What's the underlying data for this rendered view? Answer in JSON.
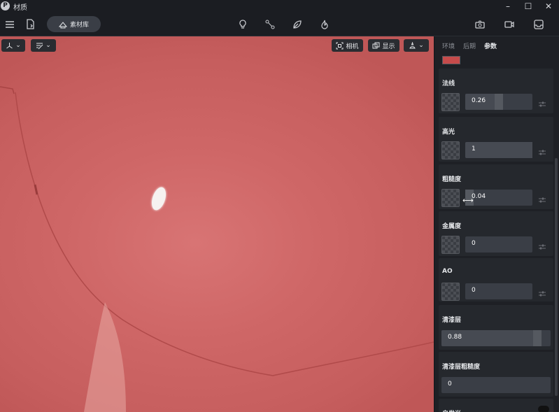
{
  "window": {
    "logo_letter": "P",
    "title": "材质",
    "minimize": "–",
    "maximize": "☐",
    "close": "✕"
  },
  "toolbar": {
    "library_label": "素材库"
  },
  "viewport": {
    "camera_label": "相机",
    "display_label": "显示",
    "chevron": "⌄"
  },
  "panel": {
    "tabs": [
      "环境",
      "后期",
      "参数"
    ],
    "active_tab": "参数",
    "base_color": "#c64b4b",
    "params": [
      {
        "label": "法线",
        "value": "0.26",
        "fill": 0.5
      },
      {
        "label": "高光",
        "value": "1",
        "fill": 1.0
      },
      {
        "label": "粗糙度",
        "value": "0.04",
        "fill": 0.04
      },
      {
        "label": "金属度",
        "value": "0",
        "fill": 0.0
      },
      {
        "label": "AO",
        "value": "0",
        "fill": 0.0
      },
      {
        "label": "清漆层",
        "value": "0.88",
        "fill": 0.88
      },
      {
        "label": "清漆层粗糙度",
        "value": "0",
        "fill": 0.0
      },
      {
        "label": "自发光",
        "value": "",
        "fill": 0.0
      }
    ]
  },
  "colors": {
    "accent": "#3a3e46",
    "material": "#d26b6b"
  }
}
